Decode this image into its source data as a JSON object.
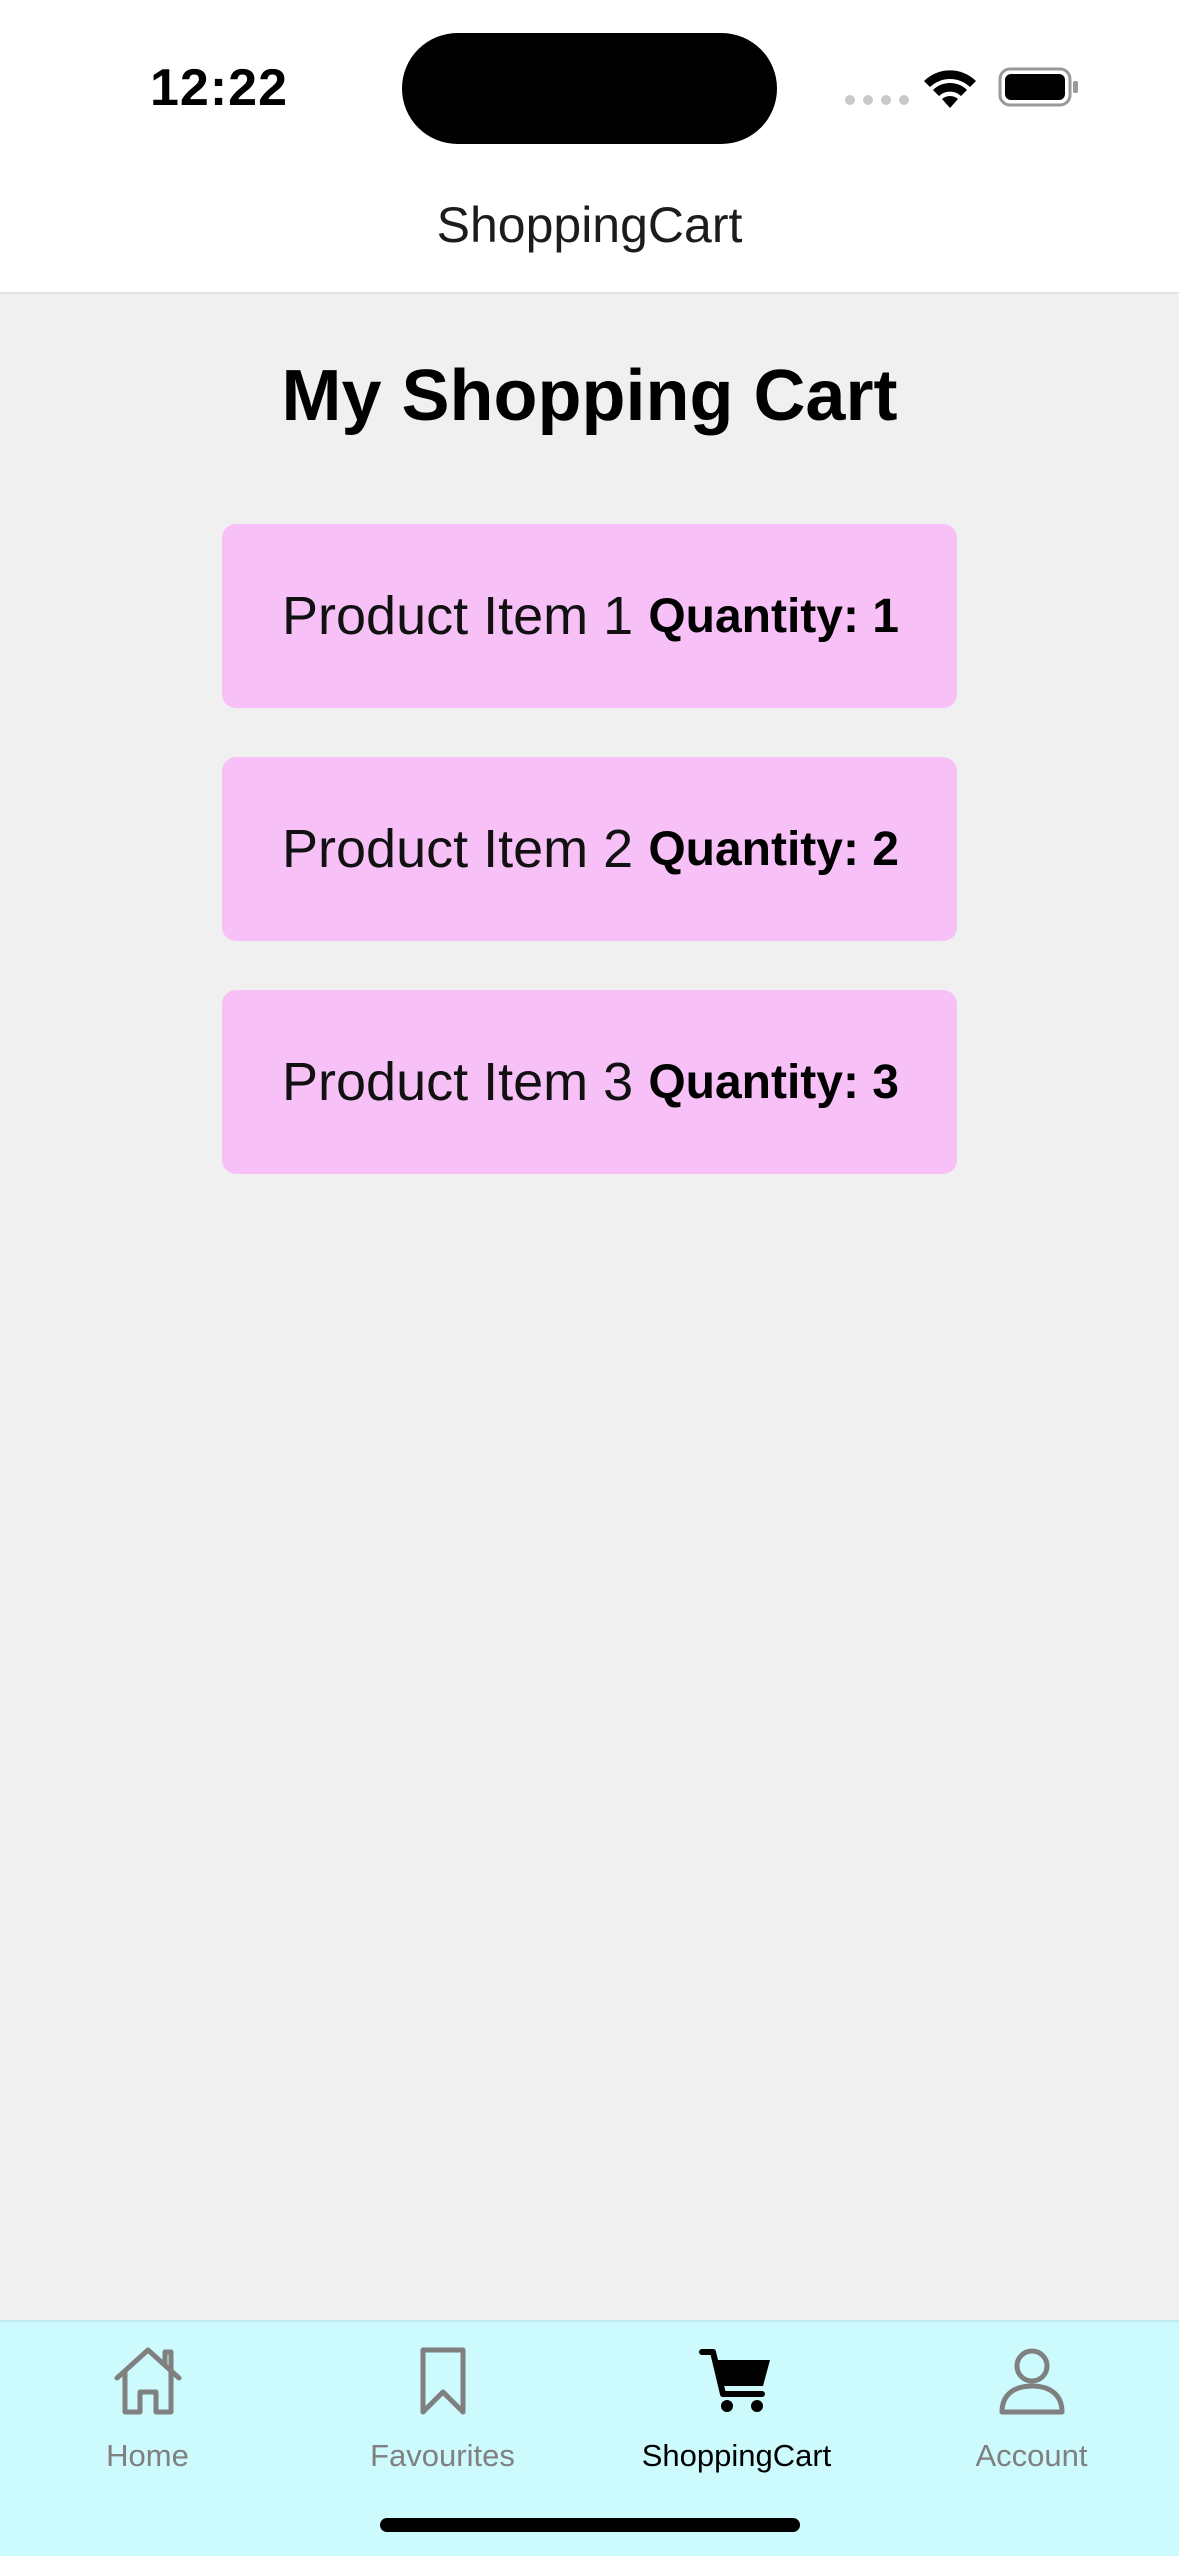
{
  "status_bar": {
    "time": "12:22",
    "icons": [
      "signal-icon",
      "wifi-icon",
      "battery-icon"
    ]
  },
  "header": {
    "title": "ShoppingCart"
  },
  "main": {
    "title": "My Shopping Cart",
    "items": [
      {
        "name": "Product Item 1",
        "quantity": "Quantity: 1"
      },
      {
        "name": "Product Item 2",
        "quantity": "Quantity: 2"
      },
      {
        "name": "Product Item 3",
        "quantity": "Quantity: 3"
      }
    ]
  },
  "tabbar": {
    "tabs": [
      {
        "label": "Home",
        "icon": "home-icon",
        "active": false
      },
      {
        "label": "Favourites",
        "icon": "bookmark-icon",
        "active": false
      },
      {
        "label": "ShoppingCart",
        "icon": "cart-icon",
        "active": true
      },
      {
        "label": "Account",
        "icon": "person-icon",
        "active": false
      }
    ]
  },
  "colors": {
    "item_background": "#f7c1f8",
    "tabbar_background": "#ccfafd",
    "page_background": "#f0f0f0",
    "inactive_tab": "#808080",
    "active_tab": "#000000"
  }
}
